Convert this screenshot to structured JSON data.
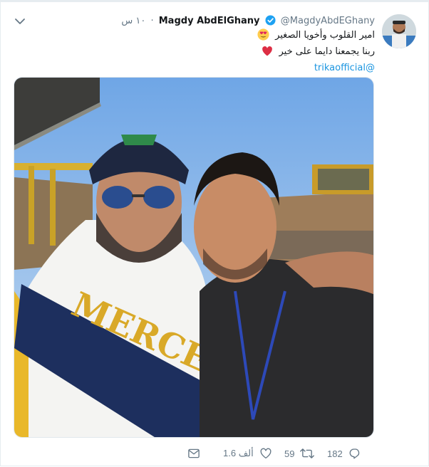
{
  "tweet": {
    "display_name": "Magdy AbdElGhany",
    "handle": "@MagdyAbdEGhany",
    "separator": "·",
    "time": "١٠ س",
    "text_line1": "امير القلوب وأخويا الصغير",
    "text_line2": "ربنا يجمعنا دايما على خير",
    "mention": "@trikaofficial",
    "media_caption": "MERCER"
  },
  "actions": {
    "reply_count": "182",
    "retweet_count": "59",
    "like_count": "1.6 ألف"
  },
  "colors": {
    "link": "#1b95e0",
    "muted": "#657786",
    "verified": "#1da1f2",
    "heart": "#e0245e"
  },
  "icons": {
    "verified": "verified-badge-icon",
    "emoji_heart_eyes": "heart-eyes-emoji-icon",
    "emoji_heart": "red-heart-emoji-icon",
    "reply": "reply-icon",
    "retweet": "retweet-icon",
    "like": "like-icon",
    "message": "direct-message-icon",
    "menu": "chevron-down-icon"
  }
}
